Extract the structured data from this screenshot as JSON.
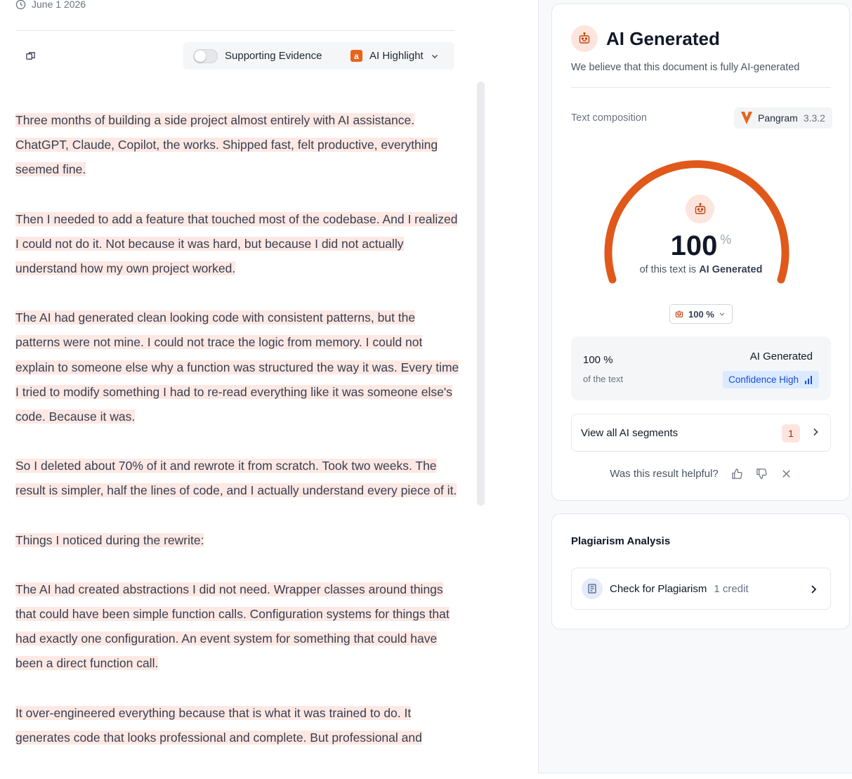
{
  "document": {
    "date": "June 1 2026",
    "toolbar": {
      "supporting_evidence_label": "Supporting Evidence",
      "supporting_evidence_on": false,
      "highlight_badge": "a",
      "highlight_label": "AI Highlight"
    },
    "paragraphs": [
      "Three months of building a side project almost entirely with AI assistance. ChatGPT, Claude, Copilot, the works. Shipped fast, felt productive, everything seemed fine.",
      "Then I needed to add a feature that touched most of the codebase. And I realized I could not do it. Not because it was hard, but because I did not actually understand how my own project worked.",
      "The AI had generated clean looking code with consistent patterns, but the patterns were not mine. I could not trace the logic from memory. I could not explain to someone else why a function was structured the way it was. Every time I tried to modify something I had to re-read everything like it was someone else's code. Because it was.",
      "So I deleted about 70% of it and rewrote it from scratch. Took two weeks. The result is simpler, half the lines of code, and I actually understand every piece of it.",
      "Things I noticed during the rewrite:",
      "The AI had created abstractions I did not need. Wrapper classes around things that could have been simple function calls. Configuration systems for things that had exactly one configuration. An event system for something that could have been a direct function call.",
      "It over-engineered everything because that is what it was trained to do. It generates code that looks professional and complete. But professional and"
    ]
  },
  "result": {
    "title": "AI Generated",
    "subtitle": "We believe that this document is fully AI-generated",
    "composition_label": "Text composition",
    "model_name": "Pangram",
    "model_version": "3.3.2",
    "gauge_value": "100",
    "gauge_percent_symbol": "%",
    "gauge_caption_prefix": "of this text is ",
    "gauge_caption_bold": "AI Generated",
    "gauge_fraction": 1.0,
    "select_value": "100 %",
    "stats": {
      "percent": "100 %",
      "of_text": "of the text",
      "category": "AI Generated",
      "confidence": "Confidence High"
    },
    "segments_label": "View all AI segments",
    "segments_count": "1",
    "helpful_question": "Was this result helpful?"
  },
  "plagiarism": {
    "title": "Plagiarism Analysis",
    "button_label": "Check for Plagiarism",
    "credit": "1 credit"
  },
  "colors": {
    "accent": "#e0591a",
    "highlight_bg": "#fde8e4",
    "confidence_bg": "#dbeafe",
    "confidence_fg": "#1d4ed8"
  }
}
